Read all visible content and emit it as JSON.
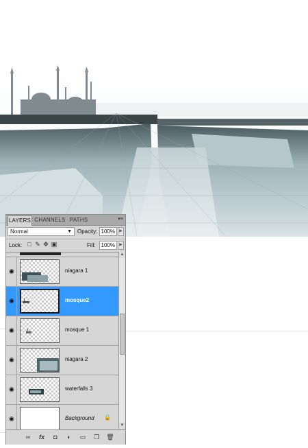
{
  "panel": {
    "tabs": [
      "LAYERS",
      "CHANNELS",
      "PATHS"
    ],
    "menu_icon": "panel-menu-icon",
    "blend_mode": "Normal",
    "opacity_label": "Opacity:",
    "opacity_value": "100%",
    "lock_label": "Lock:",
    "fill_label": "Fill:",
    "fill_value": "100%"
  },
  "layers": [
    {
      "name": "niagara 1",
      "selected": false,
      "visible": true
    },
    {
      "name": "mosque2",
      "selected": true,
      "visible": true
    },
    {
      "name": "mosque 1",
      "selected": false,
      "visible": true
    },
    {
      "name": "niagara 2",
      "selected": false,
      "visible": true
    },
    {
      "name": "waterfalls 3",
      "selected": false,
      "visible": true
    },
    {
      "name": "Background",
      "selected": false,
      "visible": true,
      "locked": true
    }
  ],
  "footer_icons": [
    "link-icon",
    "fx-icon",
    "mask-icon",
    "adjustment-icon",
    "group-icon",
    "new-layer-icon",
    "trash-icon"
  ],
  "colors": {
    "selection": "#3399ff",
    "panel": "#d6d6d6"
  }
}
